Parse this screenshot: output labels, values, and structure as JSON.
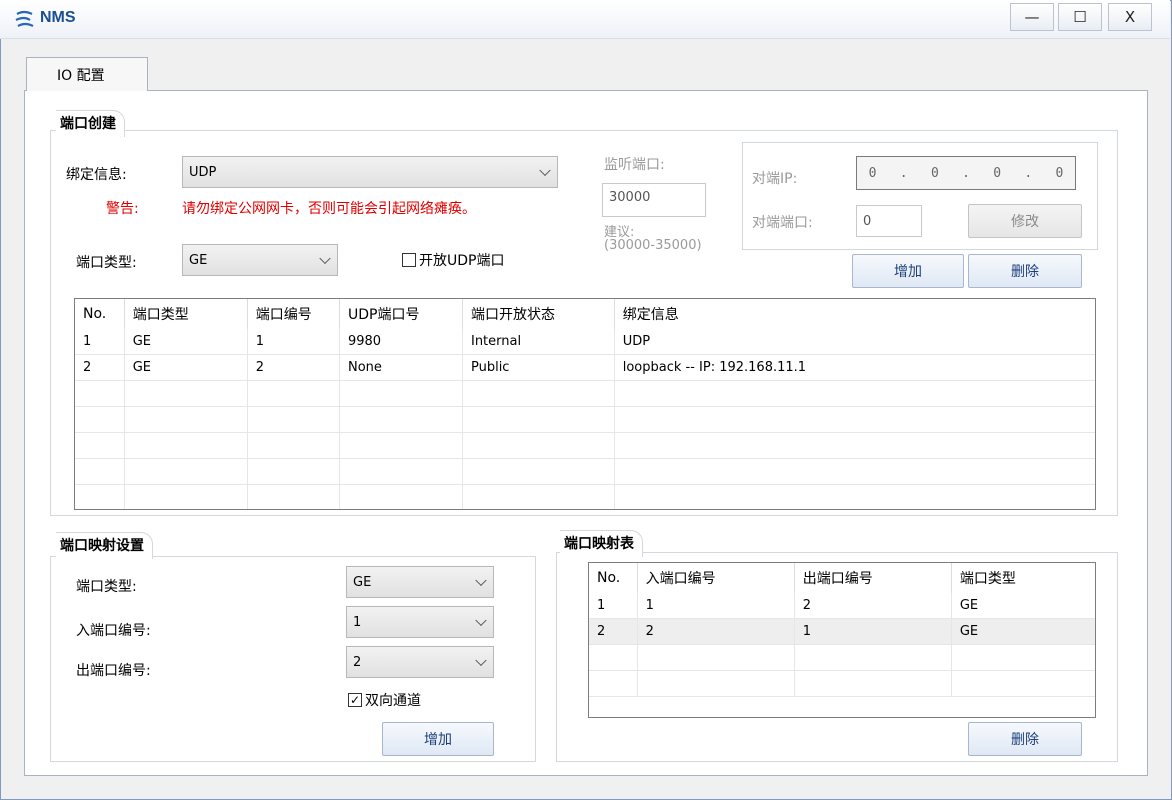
{
  "window": {
    "title": "NMS",
    "controls": {
      "minimize": "—",
      "maximize": "☐",
      "close": "X"
    }
  },
  "tab": {
    "label": "IO 配置"
  },
  "port_create": {
    "title": "端口创建",
    "bind_label": "绑定信息:",
    "bind_value": "UDP",
    "warning_label": "警告:",
    "warning_text": "请勿绑定公网网卡，否则可能会引起网络瘫痪。",
    "listen_label": "监听端口:",
    "listen_value": "30000",
    "suggest_label": "建议:",
    "suggest_range": "(30000-35000)",
    "port_type_label": "端口类型:",
    "port_type_value": "GE",
    "open_udp_label": "开放UDP端口",
    "peer_ip_label": "对端IP:",
    "peer_ip_octets": [
      "0",
      ".",
      "0",
      ".",
      "0",
      ".",
      "0"
    ],
    "peer_port_label": "对端端口:",
    "peer_port_value": "0",
    "modify_button": "修改",
    "add_button": "增加",
    "delete_button": "删除",
    "table": {
      "columns": [
        "No.",
        "端口类型",
        "端口编号",
        "UDP端口号",
        "端口开放状态",
        "绑定信息"
      ],
      "rows": [
        [
          "1",
          "GE",
          "1",
          "9980",
          "Internal",
          "UDP"
        ],
        [
          "2",
          "GE",
          "2",
          "None",
          "Public",
          "loopback -- IP: 192.168.11.1"
        ],
        [
          "",
          "",
          "",
          "",
          "",
          ""
        ],
        [
          "",
          "",
          "",
          "",
          "",
          ""
        ],
        [
          "",
          "",
          "",
          "",
          "",
          ""
        ],
        [
          "",
          "",
          "",
          "",
          "",
          ""
        ],
        [
          "",
          "",
          "",
          "",
          "",
          ""
        ]
      ]
    }
  },
  "mapping_setup": {
    "title": "端口映射设置",
    "port_type_label": "端口类型:",
    "port_type_value": "GE",
    "in_port_label": "入端口编号:",
    "in_port_value": "1",
    "out_port_label": "出端口编号:",
    "out_port_value": "2",
    "bidirectional_label": "双向通道",
    "bidirectional_checked": "✓",
    "add_button": "增加"
  },
  "mapping_table": {
    "title": "端口映射表",
    "columns": [
      "No.",
      "入端口编号",
      "出端口编号",
      "端口类型"
    ],
    "rows": [
      [
        "1",
        "1",
        "2",
        "GE"
      ],
      [
        "2",
        "2",
        "1",
        "GE"
      ],
      [
        "",
        "",
        "",
        ""
      ],
      [
        "",
        "",
        "",
        ""
      ]
    ],
    "delete_button": "删除"
  },
  "colors": {
    "warning": "#e00000",
    "title_blue": "#1a4f94",
    "button_text": "#1a3f7a"
  }
}
